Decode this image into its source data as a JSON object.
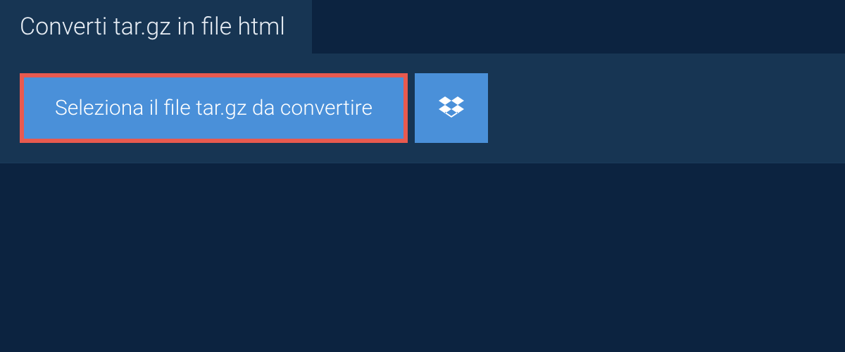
{
  "tab": {
    "title": "Converti tar.gz in file html"
  },
  "upload": {
    "select_label": "Seleziona il file tar.gz da convertire",
    "dropbox_aria": "Dropbox"
  }
}
